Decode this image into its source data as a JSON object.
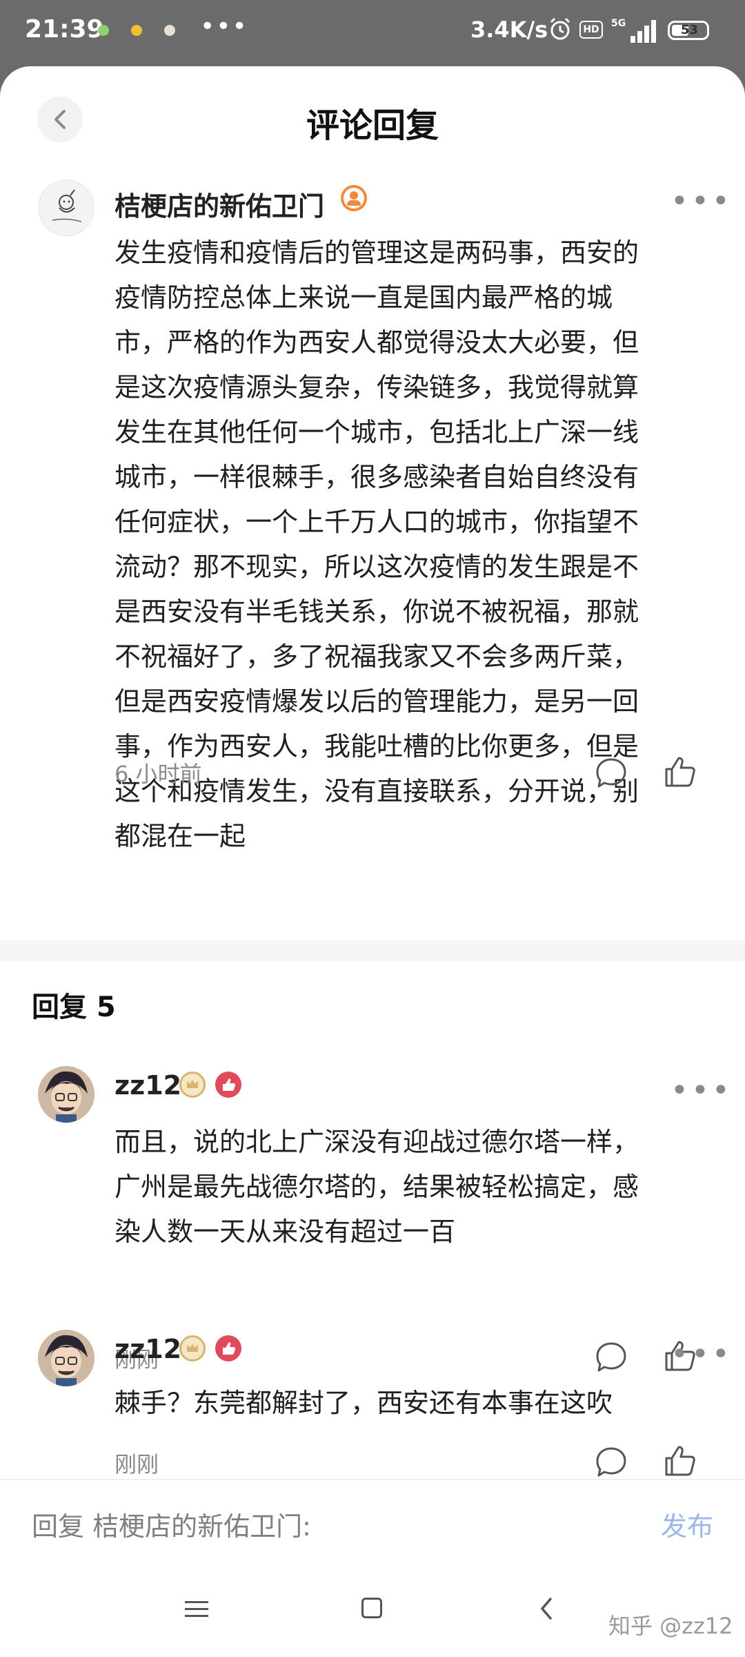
{
  "status_bar": {
    "time": "21:39",
    "more": "•••",
    "net_speed": "3.4K/s",
    "hd_label": "HD",
    "network": "5G",
    "battery_level": "53"
  },
  "header": {
    "title": "评论回复"
  },
  "main_comment": {
    "author": "桔梗店的新佑卫门",
    "more": "•••",
    "text": "发生疫情和疫情后的管理这是两码事，西安的\n疫情防控总体上来说一直是国内最严格的城\n市，严格的作为西安人都觉得没太大必要，但\n是这次疫情源头复杂，传染链多，我觉得就算\n发生在其他任何一个城市，包括北上广深一线\n城市，一样很棘手，很多感染者自始自终没有\n任何症状，一个上千万人口的城市，你指望不\n流动？那不现实，所以这次疫情的发生跟是不\n是西安没有半毛钱关系，你说不被祝福，那就\n不祝福好了，多了祝福我家又不会多两斤菜，\n但是西安疫情爆发以后的管理能力，是另一回\n事，作为西安人，我能吐槽的比你更多，但是\n这个和疫情发生，没有直接联系，分开说，别\n都混在一起",
    "time": "6 小时前"
  },
  "replies_header": "回复 5",
  "replies": [
    {
      "author": "zz12",
      "more": "•••",
      "text": "而且，说的北上广深没有迎战过德尔塔一样，\n广州是最先战德尔塔的，结果被轻松搞定，感\n染人数一天从来没有超过一百",
      "time": "刚刚"
    },
    {
      "author": "zz12",
      "more": "•••",
      "text": "棘手？东莞都解封了，西安还有本事在这吹",
      "time": "刚刚"
    }
  ],
  "input_bar": {
    "placeholder": "回复 桔梗店的新佑卫门:",
    "publish_label": "发布"
  },
  "watermark": "知乎 @zz12",
  "colors": {
    "status_bar_bg": "#6b6b6d",
    "publish": "#9ab7e8",
    "badge_red": "#e04a5a",
    "badge_gold": "#d9b36a",
    "badge_orange": "#f08a3a"
  }
}
